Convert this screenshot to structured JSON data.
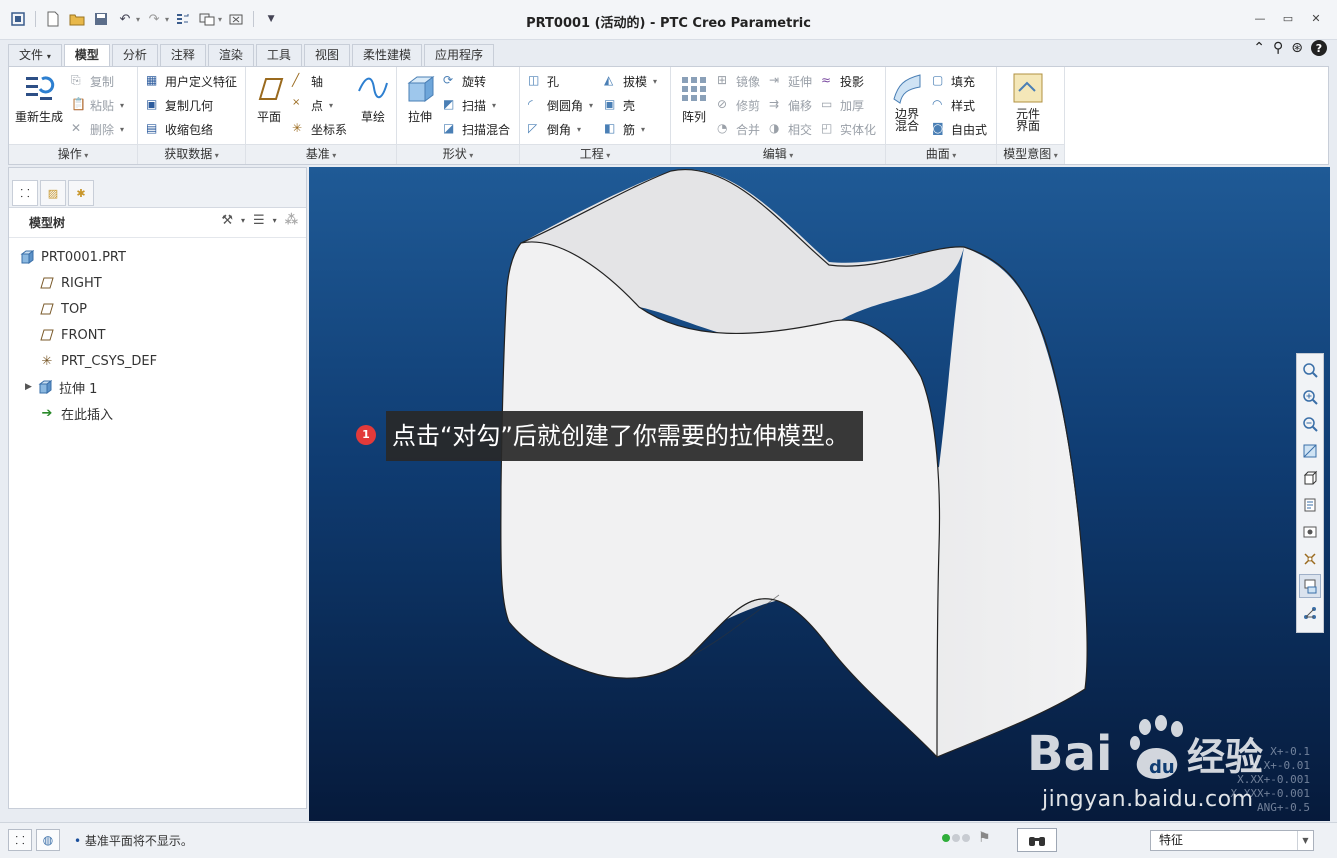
{
  "window": {
    "title": "PRT0001 (活动的) - PTC Creo Parametric"
  },
  "quick_access": [
    {
      "icon": "window-icon"
    },
    {
      "icon": "new-file-icon"
    },
    {
      "icon": "open-folder-icon"
    },
    {
      "icon": "save-icon"
    },
    {
      "icon": "undo-icon"
    },
    {
      "icon": "redo-icon"
    },
    {
      "icon": "regenerate-icon"
    },
    {
      "icon": "windows-icon"
    },
    {
      "icon": "close-window-icon"
    }
  ],
  "tabs": [
    {
      "label": "文件",
      "active": false
    },
    {
      "label": "模型",
      "active": true
    },
    {
      "label": "分析",
      "active": false
    },
    {
      "label": "注释",
      "active": false
    },
    {
      "label": "渲染",
      "active": false
    },
    {
      "label": "工具",
      "active": false
    },
    {
      "label": "视图",
      "active": false
    },
    {
      "label": "柔性建模",
      "active": false
    },
    {
      "label": "应用程序",
      "active": false
    }
  ],
  "ribbon": {
    "operations": {
      "label": "操作",
      "regenerate": "重新生成",
      "copy": "复制",
      "paste": "粘贴",
      "delete": "删除"
    },
    "get_data": {
      "label": "获取数据",
      "udf": "用户定义特征",
      "copy_geom": "复制几何",
      "shrinkwrap": "收缩包络"
    },
    "datum": {
      "label": "基准",
      "plane": "平面",
      "axis": "轴",
      "point": "点",
      "csys": "坐标系",
      "sketch": "草绘"
    },
    "shapes": {
      "label": "形状",
      "extrude": "拉伸",
      "revolve": "旋转",
      "sweep": "扫描",
      "swept_blend": "扫描混合"
    },
    "engineering": {
      "label": "工程",
      "hole": "孔",
      "round": "倒圆角",
      "chamfer": "倒角",
      "draft": "拔模",
      "shell": "壳",
      "rib": "筋"
    },
    "editing": {
      "label": "编辑",
      "pattern": "阵列",
      "mirror": "镜像",
      "trim": "修剪",
      "merge": "合并",
      "extend": "延伸",
      "offset": "偏移",
      "intersect": "相交",
      "project": "投影",
      "thicken": "加厚",
      "solidify": "实体化"
    },
    "surfaces": {
      "label": "曲面",
      "boundary_blend": "边界混合",
      "fill": "填充",
      "style": "样式",
      "freestyle": "自由式"
    },
    "model_intent": {
      "label": "模型意图",
      "component_interface": "元件界面"
    }
  },
  "model_tree": {
    "header": "模型树",
    "items": [
      {
        "label": "PRT0001.PRT",
        "icon": "part-icon"
      },
      {
        "label": "RIGHT",
        "icon": "datum-plane-icon"
      },
      {
        "label": "TOP",
        "icon": "datum-plane-icon"
      },
      {
        "label": "FRONT",
        "icon": "datum-plane-icon"
      },
      {
        "label": "PRT_CSYS_DEF",
        "icon": "csys-icon"
      },
      {
        "label": "拉伸 1",
        "icon": "extrude-icon"
      },
      {
        "label": "在此插入",
        "icon": "insert-here-icon"
      }
    ]
  },
  "callout": {
    "number": "1",
    "text": "点击“对勾”后就创建了你需要的拉伸模型。"
  },
  "tolerance": [
    "X+-0.1",
    "X.X+-0.01",
    "X.XX+-0.001",
    "X.XXX+-0.001",
    "ANG+-0.5"
  ],
  "watermark": {
    "logo": "Bai du 经验",
    "url": "jingyan.baidu.com"
  },
  "statusbar": {
    "message": "基准平面将不显示。",
    "filter": "特征"
  },
  "colors": {
    "viewport_top": "#1f5a96",
    "viewport_bottom": "#061a3b",
    "callout_badge": "#e23a3a",
    "accent": "#1a4f9c"
  }
}
